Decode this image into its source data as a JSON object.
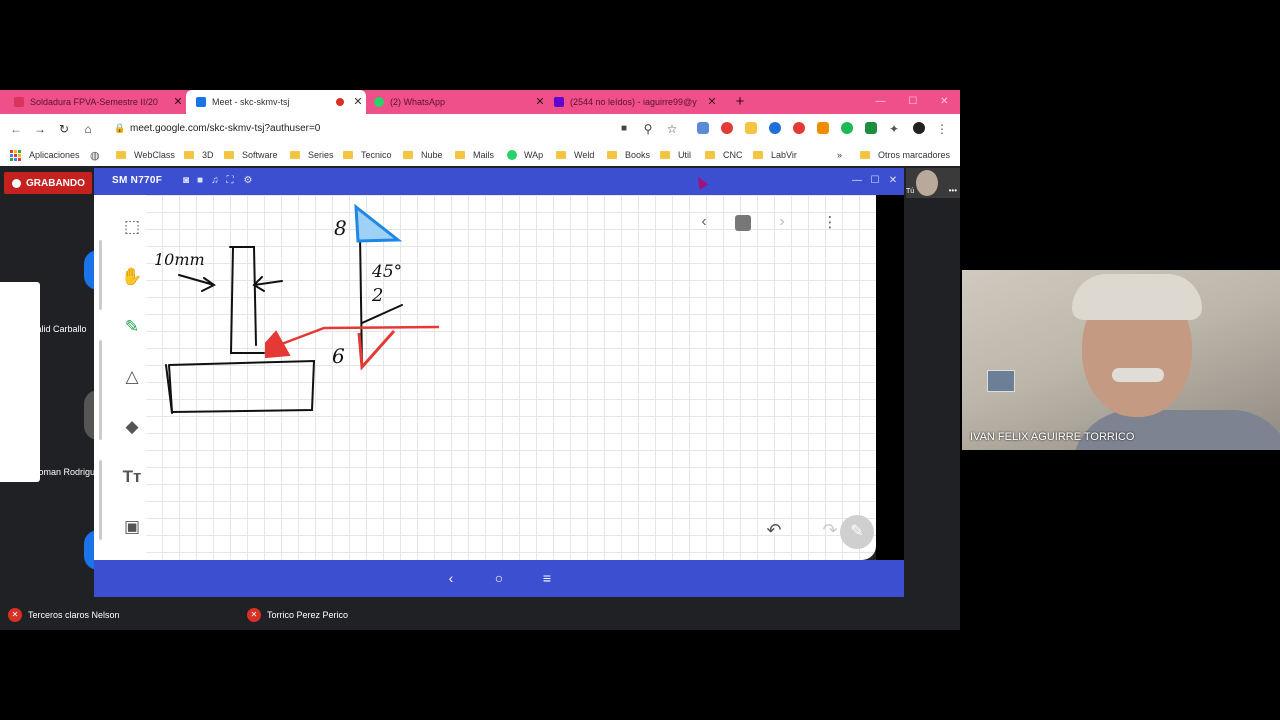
{
  "tabs": [
    {
      "title": "Soldadura FPVA-Semestre II/20",
      "color": "#d9345f"
    },
    {
      "title": "Meet - skc-skmv-tsj",
      "color": "#1a73e8"
    },
    {
      "title": "(2) WhatsApp",
      "color": "#25d366"
    },
    {
      "title": "(2544 no leídos) - iaguirre99@y",
      "color": "#6001d2"
    }
  ],
  "new_tab": "+",
  "url": "meet.google.com/skc-skmv-tsj?authuser=0",
  "bookmarks": [
    "Aplicaciones",
    "WebClass",
    "3D",
    "Software",
    "Series",
    "Tecnico",
    "Nube",
    "Mails",
    "WAp",
    "Weld",
    "Books",
    "Util",
    "CNC",
    "LabVir",
    "»",
    "Otros marcadores"
  ],
  "recording_label": "GRABANDO",
  "mirror_window": {
    "title": "SM N770F",
    "window_controls": [
      "—",
      "☐",
      "✕"
    ]
  },
  "whiteboard": {
    "annotations": [
      "10mm",
      "8",
      "45°",
      "2",
      "6"
    ]
  },
  "participants_left": [
    "Jalid Carballo",
    "Roman Rodrigu"
  ],
  "thumbnail_label": "Tú",
  "bottom_participants": [
    "Terceros claros Nelson",
    "Torrico Perez Perico"
  ],
  "video_name": "IVAN FELIX AGUIRRE TORRICO",
  "colors": {
    "tab_bar": "#f0508a",
    "mirror_blue": "#3b4fd0",
    "record_red": "#c5221f"
  }
}
